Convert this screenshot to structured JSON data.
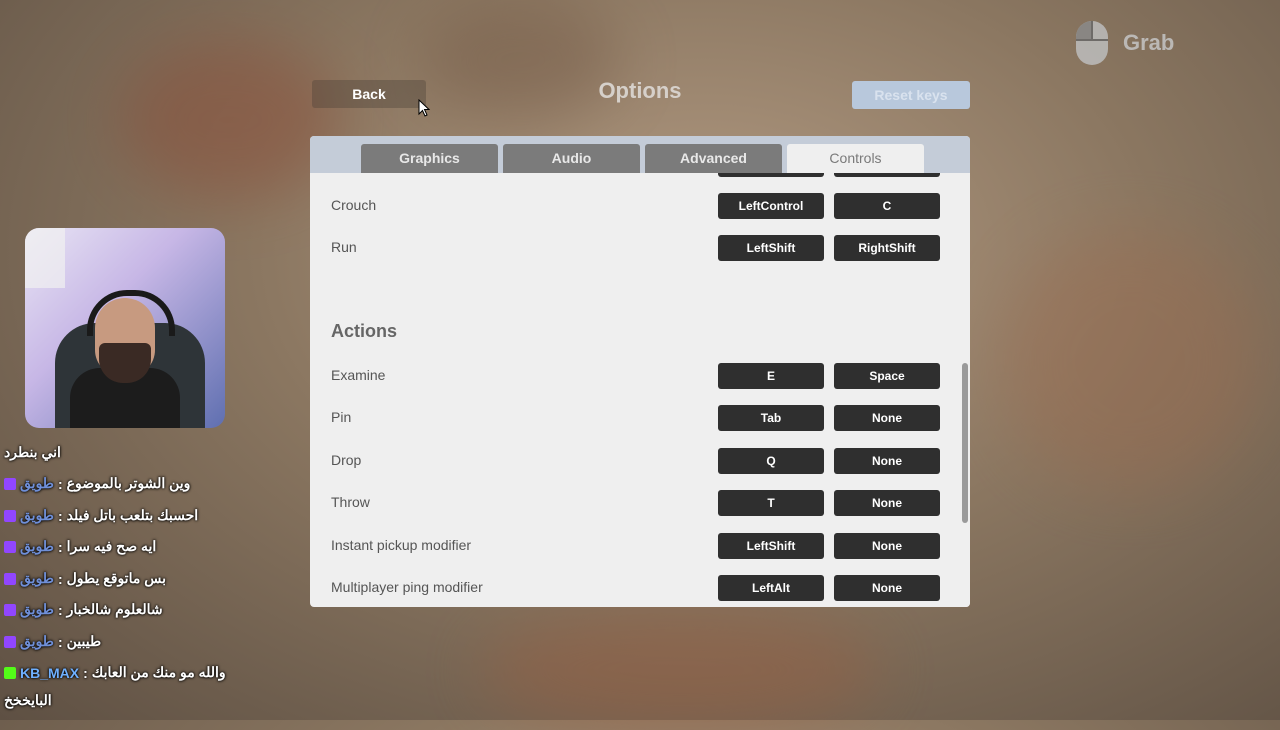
{
  "header": {
    "back_label": "Back",
    "title": "Options",
    "reset_label": "Reset keys"
  },
  "grab": {
    "label": "Grab",
    "icon": "mouse-icon"
  },
  "tabs": [
    {
      "label": "Graphics",
      "active": false
    },
    {
      "label": "Audio",
      "active": false
    },
    {
      "label": "Advanced",
      "active": false
    },
    {
      "label": "Controls",
      "active": true
    }
  ],
  "controls": {
    "movement_rows": [
      {
        "label": "Crouch",
        "primary": "LeftControl",
        "secondary": "C"
      },
      {
        "label": "Run",
        "primary": "LeftShift",
        "secondary": "RightShift"
      }
    ],
    "actions_heading": "Actions",
    "action_rows": [
      {
        "label": "Examine",
        "primary": "E",
        "secondary": "Space"
      },
      {
        "label": "Pin",
        "primary": "Tab",
        "secondary": "None"
      },
      {
        "label": "Drop",
        "primary": "Q",
        "secondary": "None"
      },
      {
        "label": "Throw",
        "primary": "T",
        "secondary": "None"
      },
      {
        "label": "Instant pickup modifier",
        "primary": "LeftShift",
        "secondary": "None"
      },
      {
        "label": "Multiplayer ping modifier",
        "primary": "LeftAlt",
        "secondary": "None"
      }
    ]
  },
  "chat": {
    "header": "اني بنطرد",
    "messages": [
      {
        "user": "طويق",
        "text": "وين الشوتر بالموضوع",
        "platform": "twitch"
      },
      {
        "user": "طويق",
        "text": "احسبك بتلعب باتل فيلد",
        "platform": "twitch"
      },
      {
        "user": "طويق",
        "text": "ايه صح فيه سرا",
        "platform": "twitch"
      },
      {
        "user": "طويق",
        "text": "بس ماتوقع يطول",
        "platform": "twitch"
      },
      {
        "user": "طويق",
        "text": "شالعلوم شالخبار",
        "platform": "twitch"
      },
      {
        "user": "طويق",
        "text": "طيبين",
        "platform": "twitch"
      },
      {
        "user": "KB_MAX",
        "text": "والله مو منك من العابك",
        "platform": "kick"
      }
    ],
    "footer": "البايخخخ"
  },
  "colors": {
    "key_bg": "#2f2f2f",
    "tab_bg": "#7b7b7b",
    "tabbar_bg": "#c4ccd8",
    "panel_bg": "#efefef",
    "reset_bg": "#b8c8dc"
  }
}
